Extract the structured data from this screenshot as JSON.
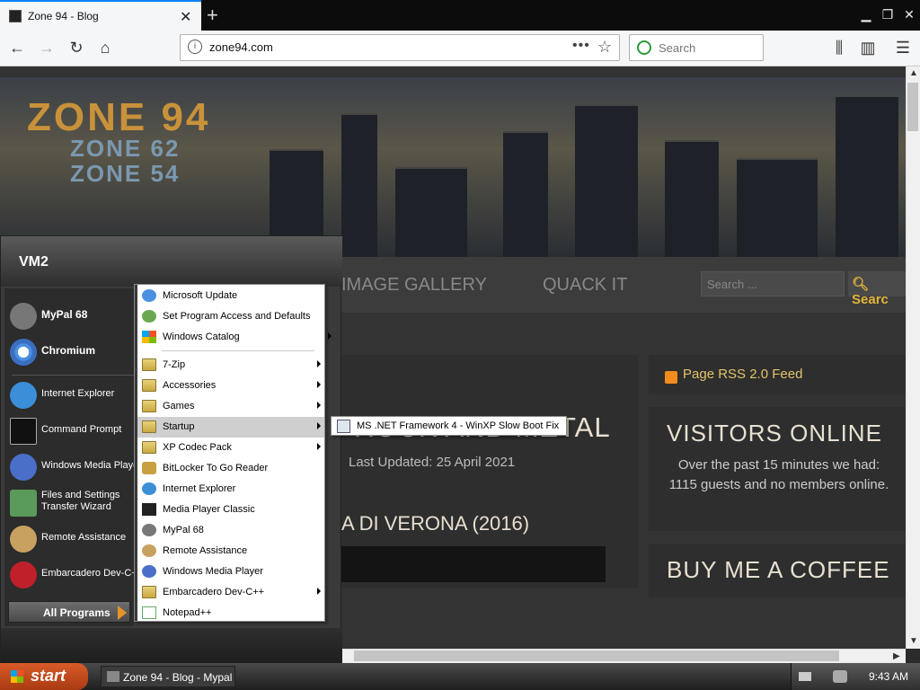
{
  "browser": {
    "tab_title": "Zone 94 - Blog",
    "url": "zone94.com",
    "search_placeholder": "Search"
  },
  "site": {
    "logo_main": "ZONE 94",
    "logo_sub1": "ZONE 62",
    "logo_sub2": "ZONE 54",
    "menu_items": [
      "IMAGE GALLERY",
      "QUACK IT"
    ],
    "search_placeholder": "Search ...",
    "search_button": "Searc",
    "article_title": "ROCK AND METAL",
    "article_date": "Last Updated: 25 April 2021",
    "article_subtitle": "A DI VERONA (2016)",
    "rss_label": "Page RSS 2.0 Feed",
    "visitors_heading": "VISITORS ONLINE",
    "visitors_text": "Over the past 15 minutes we had: 1115 guests and no members online.",
    "coffee_heading": "BUY ME A COFFEE"
  },
  "start_menu": {
    "user": "VM2",
    "pinned": [
      {
        "label": "MyPal 68",
        "bold": true,
        "icon": "raccoon-icon"
      },
      {
        "label": "Chromium",
        "bold": true,
        "icon": "chromium-icon"
      },
      {
        "label": "Internet Explorer",
        "bold": false,
        "icon": "ie-icon"
      },
      {
        "label": "Command Prompt",
        "bold": false,
        "icon": "cmd-icon"
      },
      {
        "label": "Windows Media Player",
        "bold": false,
        "icon": "wmp-icon"
      },
      {
        "label": "Files and Settings Transfer Wizard",
        "bold": false,
        "icon": "transfer-icon"
      },
      {
        "label": "Remote Assistance",
        "bold": false,
        "icon": "remote-icon"
      },
      {
        "label": "Embarcadero Dev-C++",
        "bold": false,
        "icon": "devcpp-icon"
      }
    ],
    "all_programs": "All Programs"
  },
  "programs_menu": [
    {
      "label": "Microsoft Update",
      "arrow": false
    },
    {
      "label": "Set Program Access and Defaults",
      "arrow": false
    },
    {
      "label": "Windows Catalog",
      "arrow": false
    },
    {
      "label": "7-Zip",
      "arrow": true
    },
    {
      "label": "Accessories",
      "arrow": true
    },
    {
      "label": "Games",
      "arrow": true
    },
    {
      "label": "Startup",
      "arrow": true
    },
    {
      "label": "XP Codec Pack",
      "arrow": true
    },
    {
      "label": "BitLocker To Go Reader",
      "arrow": false
    },
    {
      "label": "Internet Explorer",
      "arrow": false
    },
    {
      "label": "Media Player Classic",
      "arrow": false
    },
    {
      "label": "MyPal 68",
      "arrow": false
    },
    {
      "label": "Remote Assistance",
      "arrow": false
    },
    {
      "label": "Windows Media Player",
      "arrow": false
    },
    {
      "label": "Embarcadero Dev-C++",
      "arrow": true
    },
    {
      "label": "Notepad++",
      "arrow": false
    }
  ],
  "startup_submenu": {
    "label": "MS .NET Framework 4 - WinXP Slow Boot Fix"
  },
  "taskbar": {
    "start_label": "start",
    "task_item": "Zone 94 - Blog - Mypal",
    "clock": "9:43 AM"
  },
  "colors": {
    "accent_tab": "#0a84ff",
    "start_button": "#c94a1c",
    "site_gold": "#e3c46a"
  }
}
